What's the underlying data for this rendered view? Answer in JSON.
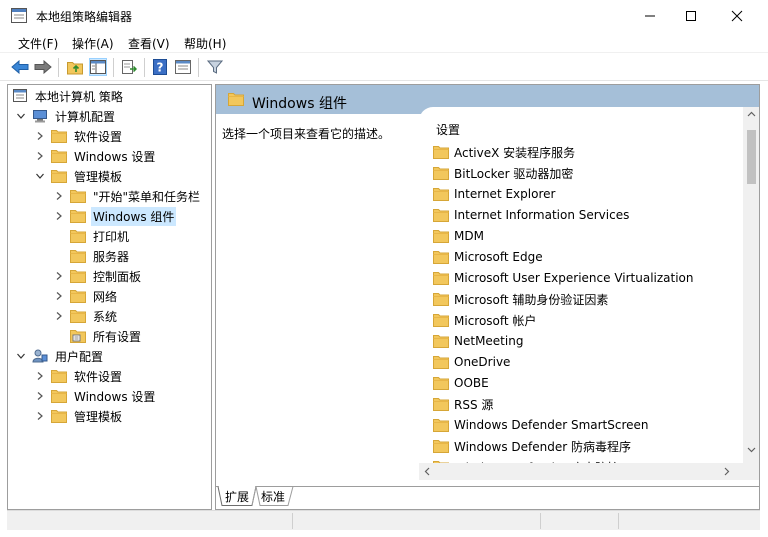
{
  "window": {
    "title": "本地组策略编辑器"
  },
  "menu": [
    "文件(F)",
    "操作(A)",
    "查看(V)",
    "帮助(H)"
  ],
  "toolbar": [
    "back-arrow-icon",
    "forward-arrow-icon",
    "up-folder-icon",
    "show-tree-icon",
    "export-list-icon",
    "help-icon",
    "properties-icon",
    "filter-icon"
  ],
  "tree": {
    "root": "本地计算机 策略",
    "computer_config": "计算机配置",
    "software_settings": "软件设置",
    "windows_settings": "Windows 设置",
    "admin_templates": "管理模板",
    "start_menu": "\"开始\"菜单和任务栏",
    "windows_components": "Windows 组件",
    "printers": "打印机",
    "servers": "服务器",
    "control_panel": "控制面板",
    "network": "网络",
    "system": "系统",
    "all_settings": "所有设置",
    "user_config": "用户配置",
    "user_software_settings": "软件设置",
    "user_windows_settings": "Windows 设置",
    "user_admin_templates": "管理模板"
  },
  "panel": {
    "header_title": "Windows 组件",
    "description": "选择一个项目来查看它的描述。",
    "list_header": "设置",
    "items": [
      "ActiveX 安装程序服务",
      "BitLocker 驱动器加密",
      "Internet Explorer",
      "Internet Information Services",
      "MDM",
      "Microsoft Edge",
      "Microsoft User Experience Virtualization",
      "Microsoft 辅助身份验证因素",
      "Microsoft 帐户",
      "NetMeeting",
      "OneDrive",
      "OOBE",
      "RSS 源",
      "Windows Defender SmartScreen",
      "Windows Defender 防病毒程序",
      "Windows Defender 攻击防护"
    ]
  },
  "tabs": {
    "extended": "扩展",
    "standard": "标准"
  },
  "colors": {
    "header_band": "#a5bfd8",
    "folder": "#f2c75c",
    "selection": "#cce8ff"
  }
}
